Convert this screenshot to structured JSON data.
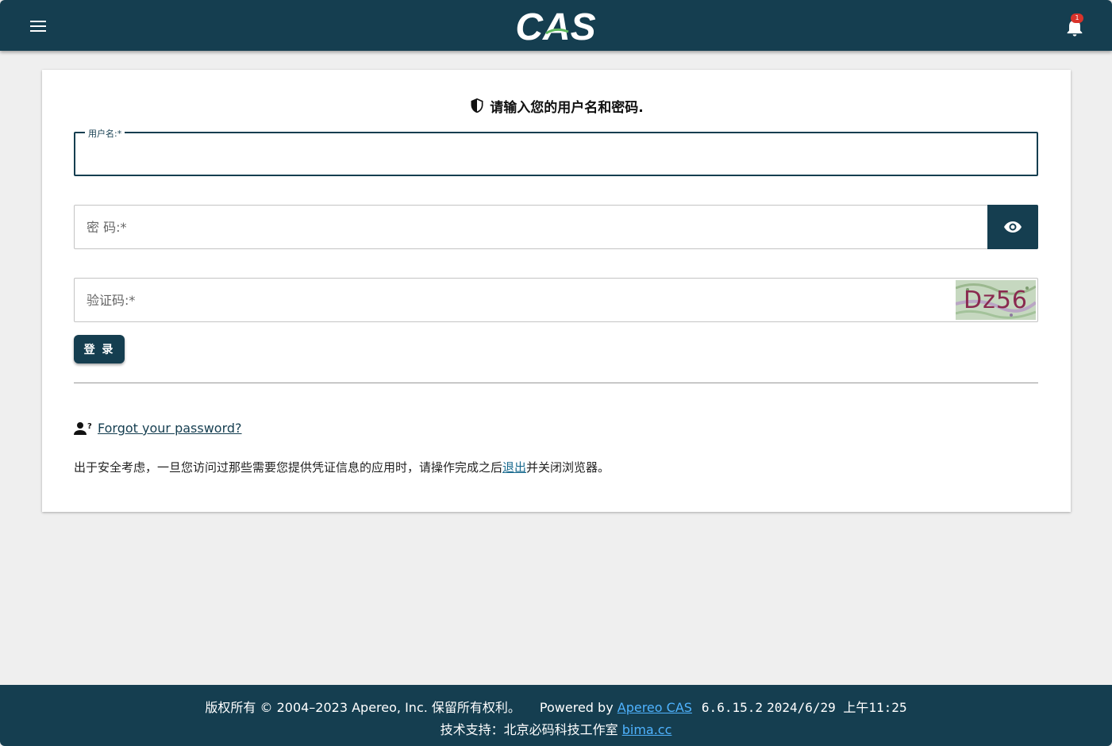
{
  "header": {
    "logo_text": "CAS",
    "notification_count": "1",
    "colors": {
      "bar": "#153e50",
      "badge": "#d9332b"
    },
    "icons": [
      "menu-icon",
      "bell-icon"
    ]
  },
  "login": {
    "heading": "请输入您的用户名和密码.",
    "username_label": "用户名:*",
    "username_value": "",
    "password_placeholder": "密 码:*",
    "captcha_placeholder": "验证码:*",
    "captcha_text": "Dz56",
    "submit_label": "登 录",
    "forgot_label": "Forgot your password?",
    "notice_before": "出于安全考虑，一旦您访问过那些需要您提供凭证信息的应用时，请操作完成之后",
    "notice_link": "退出",
    "notice_after": "并关闭浏览器。"
  },
  "footer": {
    "copyright": "版权所有 © 2004–2023 Apereo, Inc. 保留所有权利。",
    "powered_by": "Powered by",
    "powered_link": "Apereo CAS",
    "version": "6.6.15.2",
    "datetime": "2024/6/29 上午11:25",
    "support": "技术支持：北京必码科技工作室",
    "support_link": "bima.cc",
    "link_color": "#4fb3ff"
  }
}
